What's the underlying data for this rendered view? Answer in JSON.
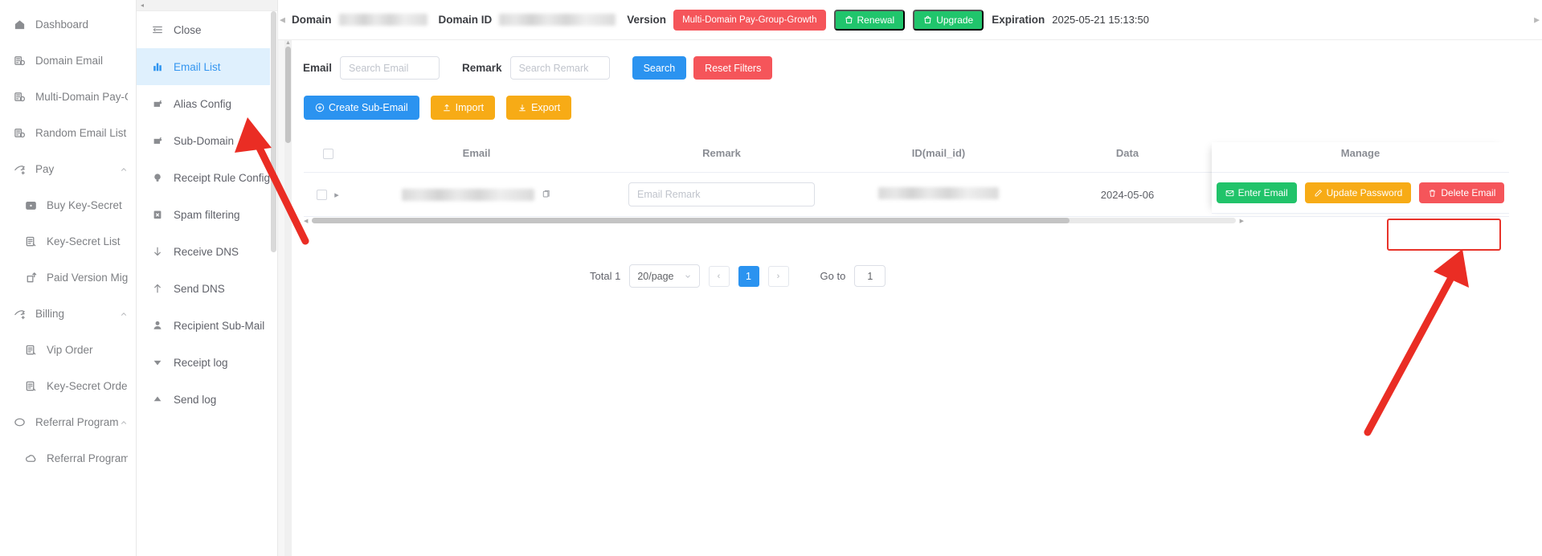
{
  "sidebar": {
    "items": [
      {
        "label": "Dashboard",
        "icon": "home-icon",
        "level": 0,
        "caret": false
      },
      {
        "label": "Domain Email",
        "icon": "domain-email-icon",
        "level": 0,
        "caret": false
      },
      {
        "label": "Multi-Domain Pay-Group",
        "icon": "domain-email-icon",
        "level": 0,
        "caret": false
      },
      {
        "label": "Random Email List",
        "icon": "domain-email-icon",
        "level": 0,
        "caret": false
      },
      {
        "label": "Pay",
        "icon": "pay-icon",
        "level": 0,
        "caret": true
      },
      {
        "label": "Buy Key-Secret",
        "icon": "wallet-icon",
        "level": 1,
        "caret": false
      },
      {
        "label": "Key-Secret List",
        "icon": "list-doc-icon",
        "level": 1,
        "caret": false
      },
      {
        "label": "Paid Version Migration",
        "icon": "migration-icon",
        "level": 1,
        "caret": false
      },
      {
        "label": "Billing",
        "icon": "pay-icon",
        "level": 0,
        "caret": true
      },
      {
        "label": "Vip Order",
        "icon": "list-doc-icon",
        "level": 1,
        "caret": false
      },
      {
        "label": "Key-Secret Order",
        "icon": "list-doc-icon",
        "level": 1,
        "caret": false
      },
      {
        "label": "Referral Program",
        "icon": "referral-icon",
        "level": 0,
        "caret": true
      },
      {
        "label": "Referral Program",
        "icon": "referral-cloud-icon",
        "level": 1,
        "caret": false
      }
    ]
  },
  "panel2": {
    "collapse_glyph": "◂",
    "items": [
      {
        "label": "Close",
        "icon": "close-panel-icon",
        "active": false
      },
      {
        "label": "Email List",
        "icon": "bar-chart-icon",
        "active": true
      },
      {
        "label": "Alias Config",
        "icon": "alias-icon",
        "active": false
      },
      {
        "label": "Sub-Domain",
        "icon": "alias-icon",
        "active": false
      },
      {
        "label": "Receipt Rule Config",
        "icon": "bulb-icon",
        "active": false
      },
      {
        "label": "Spam filtering",
        "icon": "spam-icon",
        "active": false
      },
      {
        "label": "Receive DNS",
        "icon": "arrow-down-icon",
        "active": false
      },
      {
        "label": "Send DNS",
        "icon": "arrow-up-icon",
        "active": false
      },
      {
        "label": "Recipient Sub-Mail",
        "icon": "user-icon",
        "active": false
      },
      {
        "label": "Receipt log",
        "icon": "triangle-down-icon",
        "active": false
      },
      {
        "label": "Send log",
        "icon": "triangle-up-icon",
        "active": false
      }
    ]
  },
  "topbar": {
    "domain_label": "Domain",
    "domain_value": "",
    "domain_id_label": "Domain ID",
    "domain_id_value": "",
    "version_label": "Version",
    "version_badge": "Multi-Domain Pay-Group-Growth",
    "renewal_label": "Renewal",
    "upgrade_label": "Upgrade",
    "expiration_label": "Expiration",
    "expiration_value": "2025-05-21 15:13:50",
    "version_badge_color": "#f5555a",
    "action_color": "#20c56c"
  },
  "filters": {
    "email_label": "Email",
    "email_placeholder": "Search Email",
    "email_value": "",
    "remark_label": "Remark",
    "remark_placeholder": "Search Remark",
    "remark_value": "",
    "search_button": "Search",
    "reset_button": "Reset Filters"
  },
  "actions": {
    "create_sub_email": "Create Sub-Email",
    "import": "Import",
    "export": "Export"
  },
  "table": {
    "columns": [
      "",
      "Email",
      "Remark",
      "ID(mail_id)",
      "Data",
      "Manage"
    ],
    "manage_header": "Manage",
    "rows": [
      {
        "checked": false,
        "email": "",
        "remark_placeholder": "Email Remark",
        "remark_value": "",
        "mail_id": "",
        "date": "2024-05-06",
        "actions": [
          {
            "label": "Enter Email",
            "color": "green",
            "icon": "envelope-icon"
          },
          {
            "label": "Update Password",
            "color": "orange",
            "icon": "pencil-icon"
          },
          {
            "label": "Delete Email",
            "color": "red",
            "icon": "trash-icon"
          }
        ]
      }
    ]
  },
  "pagination": {
    "total_label": "Total 1",
    "page_size": "20/page",
    "prev_glyph": "‹",
    "next_glyph": "›",
    "current_page": "1",
    "goto_label": "Go to",
    "goto_value": "1"
  },
  "annotations": {
    "accent": "#e8332a",
    "arrow_to_email_list": "arrow-pointing-email-list",
    "arrow_to_delete_email": "arrow-pointing-delete-email",
    "highlight_delete_email": "delete-email-highlight-box"
  }
}
